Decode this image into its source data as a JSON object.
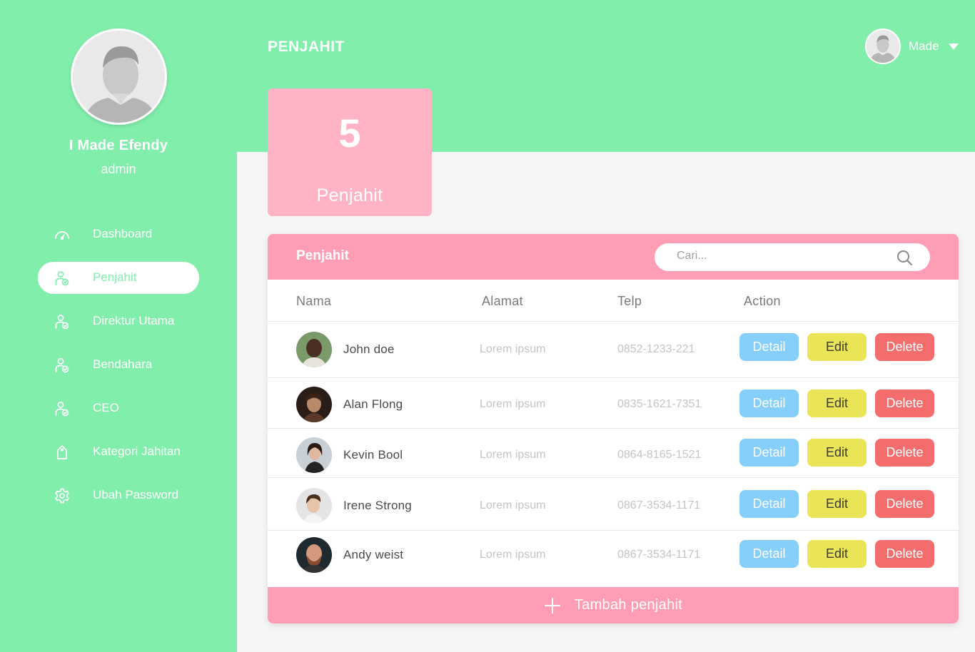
{
  "sidebar": {
    "user_name": "I Made Efendy",
    "user_role": "admin",
    "items": [
      {
        "label": "Dashboard",
        "icon": "gauge-icon",
        "active": false
      },
      {
        "label": "Penjahit",
        "icon": "user-check-icon",
        "active": true
      },
      {
        "label": "Direktur Utama",
        "icon": "user-check-icon",
        "active": false
      },
      {
        "label": "Bendahara",
        "icon": "user-check-icon",
        "active": false
      },
      {
        "label": "CEO",
        "icon": "user-check-icon",
        "active": false
      },
      {
        "label": "Kategori Jahitan",
        "icon": "tag-icon",
        "active": false
      },
      {
        "label": "Ubah Password",
        "icon": "gear-icon",
        "active": false
      }
    ]
  },
  "header": {
    "title": "PENJAHIT",
    "user_menu_label": "Made"
  },
  "stat_card": {
    "value": "5",
    "label": "Penjahit"
  },
  "table": {
    "title": "Penjahit",
    "search_placeholder": "Cari...",
    "columns": [
      "Nama",
      "Alamat",
      "Telp",
      "Action"
    ],
    "rows": [
      {
        "name": "John doe",
        "alamat": "Lorem ipsum",
        "telp": "0852-1233-221"
      },
      {
        "name": "Alan Flong",
        "alamat": "Lorem ipsum",
        "telp": "0835-1621-7351"
      },
      {
        "name": "Kevin Bool",
        "alamat": "Lorem ipsum",
        "telp": "0864-8165-1521"
      },
      {
        "name": "Irene Strong",
        "alamat": "Lorem ipsum",
        "telp": "0867-3534-1171"
      },
      {
        "name": "Andy weist",
        "alamat": "Lorem ipsum",
        "telp": "0867-3534-1171"
      }
    ],
    "actions": {
      "detail": "Detail",
      "edit": "Edit",
      "delete": "Delete"
    },
    "add_label": "Tambah penjahit"
  },
  "colors": {
    "primary_green": "#82eeac",
    "accent_pink": "#ff9db5",
    "detail_blue": "#87cffb",
    "edit_yellow": "#e9e556",
    "delete_red": "#f46d6d"
  }
}
